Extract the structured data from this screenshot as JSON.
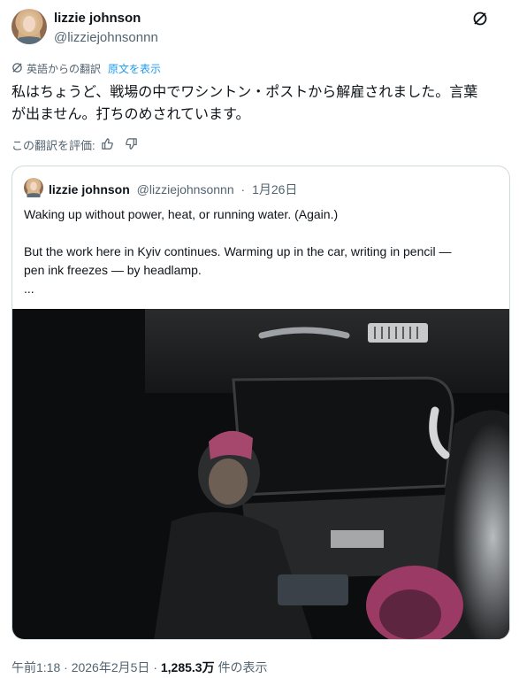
{
  "author": {
    "display_name": "lizzie johnson",
    "handle": "@lizziejohnsonnn"
  },
  "translation": {
    "label": "英語からの翻訳",
    "show_original": "原文を表示",
    "rate_label": "この翻訳を評価:"
  },
  "tweet": {
    "text_line1": "私はちょうど、戦場の中でワシントン・ポストから解雇されました。言葉",
    "text_line2": "が出ません。打ちのめされています。"
  },
  "quoted_tweet": {
    "display_name": "lizzie johnson",
    "handle": "@lizziejohnsonnn",
    "separator": "·",
    "date": "1月26日",
    "line1": "Waking up without power, heat, or running water. (Again.)",
    "line2": "But the work here in Kyiv continues. Warming up in the car, writing in pencil —",
    "line3": "pen ink freezes — by headlamp.",
    "line4": "...",
    "photo_icon": "car-interior-photo"
  },
  "footer": {
    "time": "午前1:18",
    "sep1": "·",
    "date": "2026年2月5日",
    "sep2": "·",
    "views": "1,285.3万",
    "views_label": "件の表示"
  },
  "icons": {
    "translate": "translate-icon",
    "thumbs_up": "thumbs-up-icon",
    "thumbs_down": "thumbs-down-icon",
    "grok": "grok-icon"
  }
}
